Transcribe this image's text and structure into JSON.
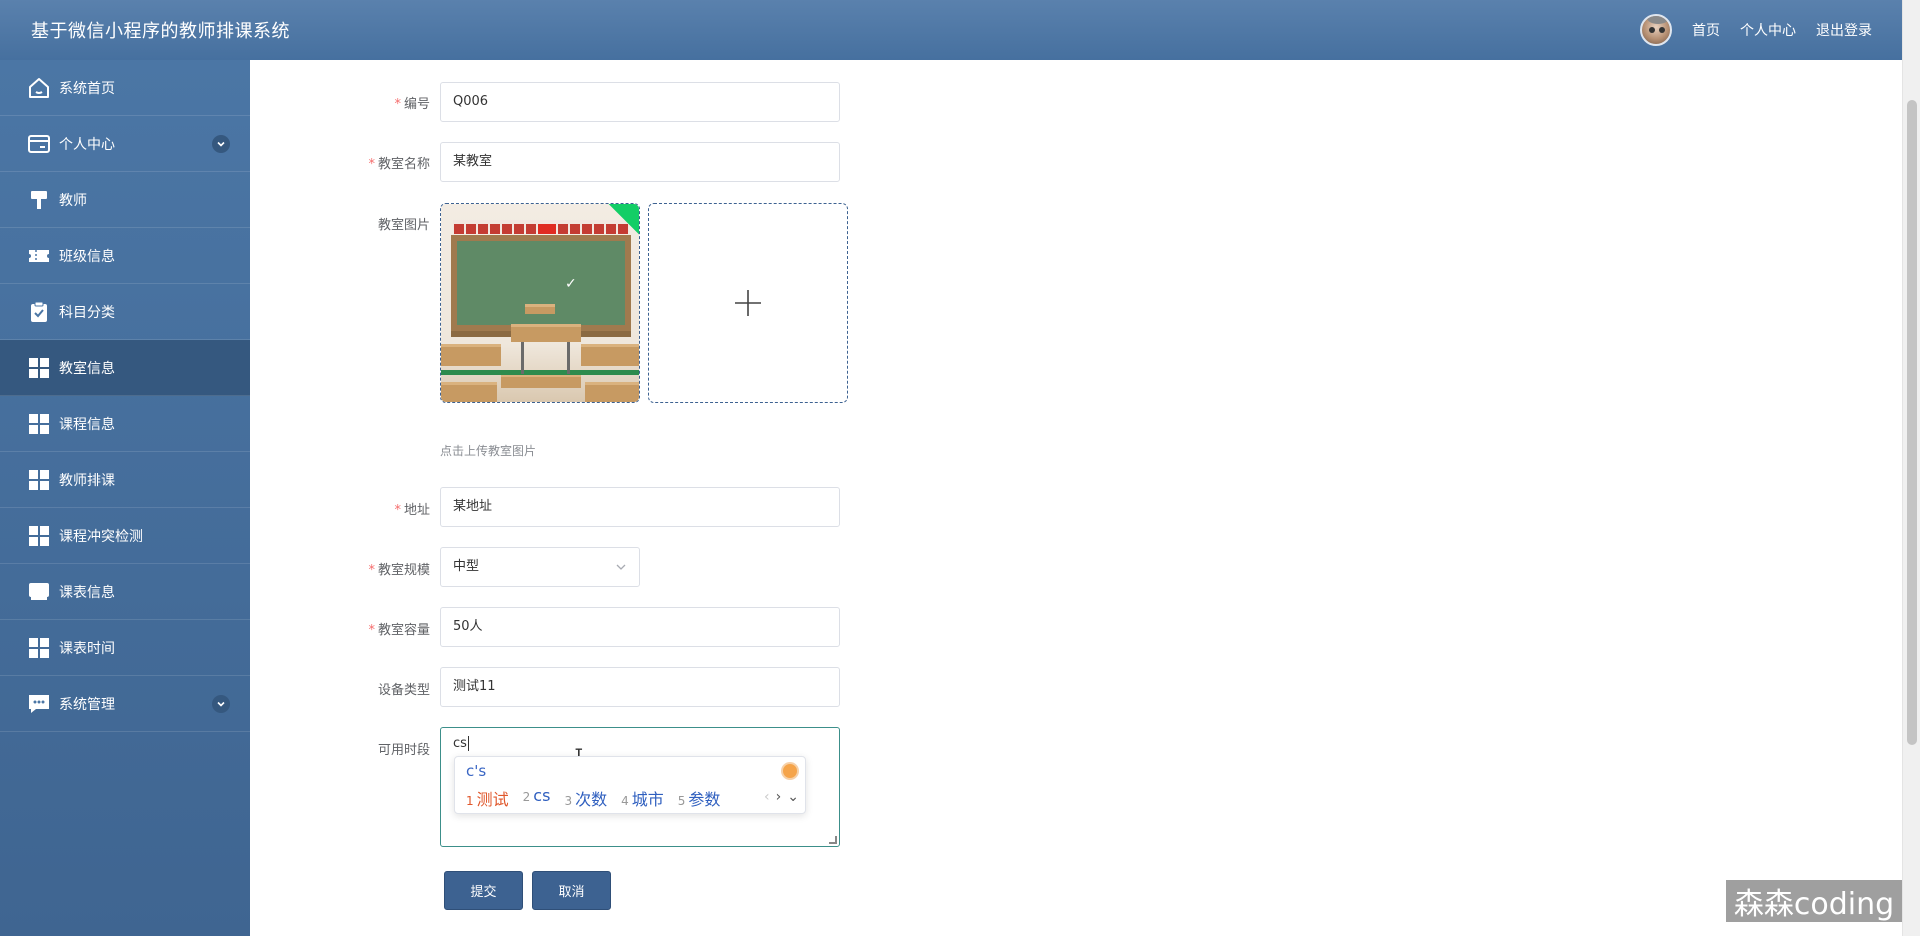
{
  "header": {
    "app_title": "基于微信小程序的教师排课系统",
    "links": [
      "首页",
      "个人中心",
      "退出登录"
    ]
  },
  "sidebar": {
    "items": [
      {
        "label": "系统首页",
        "icon": "home-icon"
      },
      {
        "label": "个人中心",
        "icon": "card-icon",
        "expandable": true
      },
      {
        "label": "教师",
        "icon": "brush-icon"
      },
      {
        "label": "班级信息",
        "icon": "ticket-icon"
      },
      {
        "label": "科目分类",
        "icon": "clipboard-check-icon"
      },
      {
        "label": "教室信息",
        "icon": "grid-icon",
        "active": true
      },
      {
        "label": "课程信息",
        "icon": "grid-icon"
      },
      {
        "label": "教师排课",
        "icon": "grid-icon"
      },
      {
        "label": "课程冲突检测",
        "icon": "grid-icon"
      },
      {
        "label": "课表信息",
        "icon": "monitor-icon"
      },
      {
        "label": "课表时间",
        "icon": "grid-icon"
      },
      {
        "label": "系统管理",
        "icon": "chat-icon",
        "expandable": true
      }
    ]
  },
  "form": {
    "code": {
      "label": "编号",
      "value": "Q006",
      "required": true
    },
    "name": {
      "label": "教室名称",
      "value": "某教室",
      "required": true
    },
    "image": {
      "label": "教室图片",
      "hint": "点击上传教室图片"
    },
    "address": {
      "label": "地址",
      "value": "某地址",
      "required": true
    },
    "scale": {
      "label": "教室规模",
      "value": "中型",
      "required": true
    },
    "capacity": {
      "label": "教室容量",
      "value": "50人",
      "required": true
    },
    "equipment": {
      "label": "设备类型",
      "value": "测试11"
    },
    "available": {
      "label": "可用时段",
      "value": "cs"
    },
    "submit_label": "提交",
    "cancel_label": "取消"
  },
  "ime": {
    "pinyin": "c's",
    "candidates": [
      {
        "num": "1",
        "text": "测试"
      },
      {
        "num": "2",
        "text": "cs"
      },
      {
        "num": "3",
        "text": "次数"
      },
      {
        "num": "4",
        "text": "城市"
      },
      {
        "num": "5",
        "text": "参数"
      }
    ]
  },
  "watermark": "森森coding"
}
